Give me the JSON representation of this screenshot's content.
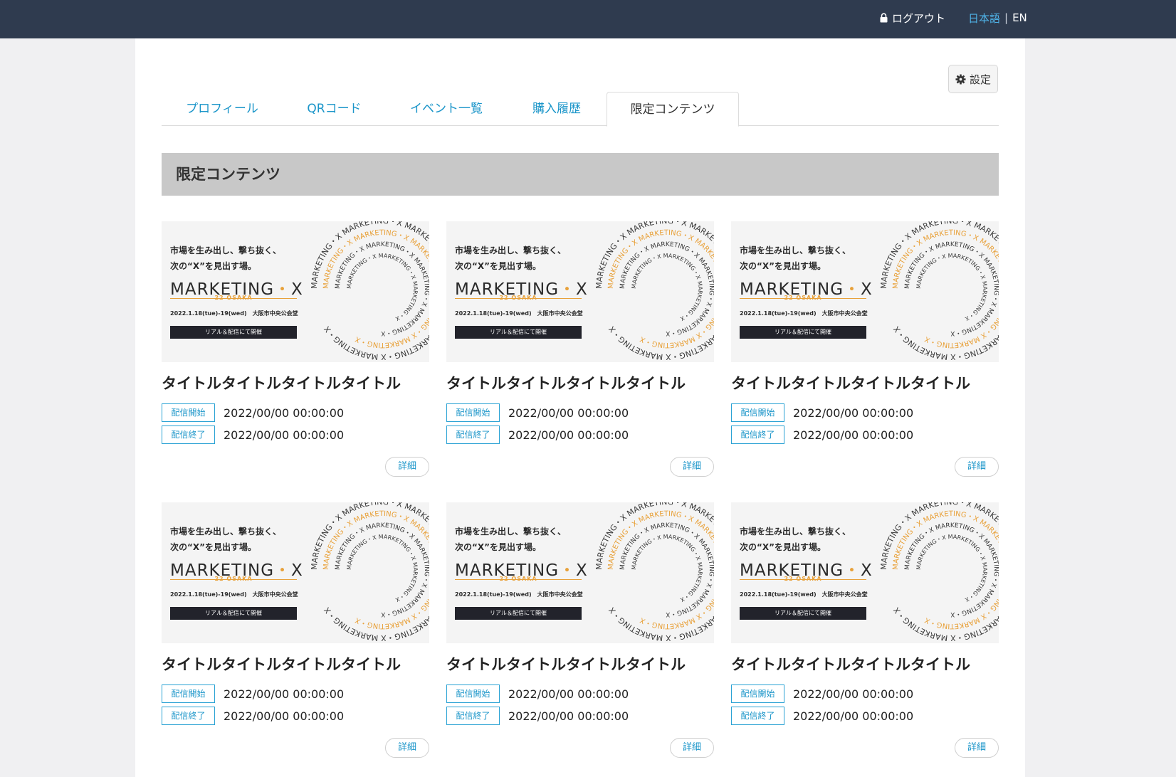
{
  "header": {
    "logout_label": "ログアウト",
    "lang_ja": "日本語",
    "lang_sep": "|",
    "lang_en": "EN"
  },
  "settings_label": "設定",
  "tabs": [
    {
      "label": "プロフィール",
      "active": false
    },
    {
      "label": "QRコード",
      "active": false
    },
    {
      "label": "イベント一覧",
      "active": false
    },
    {
      "label": "購入履歴",
      "active": false
    },
    {
      "label": "限定コンテンツ",
      "active": true
    }
  ],
  "section_title": "限定コンテンツ",
  "thumbnail": {
    "line1": "市場を生み出し、撃ち抜く、",
    "line2": "次の“X”を見出す場。",
    "logo_left": "MARKETING",
    "logo_dot": "・",
    "logo_right": "X",
    "sub": "22 OSAKA",
    "date": "2022.1.18(tue)-19(wed)　大阪市中央公会堂",
    "bar": "リアル＆配信にて開催",
    "ring_text": "MARKETING・X"
  },
  "cards": [
    {
      "title": "タイトルタイトルタイトルタイトル",
      "start_badge": "配信開始",
      "start": "2022/00/00 00:00:00",
      "end_badge": "配信終了",
      "end": "2022/00/00 00:00:00",
      "detail": "詳細"
    },
    {
      "title": "タイトルタイトルタイトルタイトル",
      "start_badge": "配信開始",
      "start": "2022/00/00 00:00:00",
      "end_badge": "配信終了",
      "end": "2022/00/00 00:00:00",
      "detail": "詳細"
    },
    {
      "title": "タイトルタイトルタイトルタイトル",
      "start_badge": "配信開始",
      "start": "2022/00/00 00:00:00",
      "end_badge": "配信終了",
      "end": "2022/00/00 00:00:00",
      "detail": "詳細"
    },
    {
      "title": "タイトルタイトルタイトルタイトル",
      "start_badge": "配信開始",
      "start": "2022/00/00 00:00:00",
      "end_badge": "配信終了",
      "end": "2022/00/00 00:00:00",
      "detail": "詳細"
    },
    {
      "title": "タイトルタイトルタイトルタイトル",
      "start_badge": "配信開始",
      "start": "2022/00/00 00:00:00",
      "end_badge": "配信終了",
      "end": "2022/00/00 00:00:00",
      "detail": "詳細"
    },
    {
      "title": "タイトルタイトルタイトルタイトル",
      "start_badge": "配信開始",
      "start": "2022/00/00 00:00:00",
      "end_badge": "配信終了",
      "end": "2022/00/00 00:00:00",
      "detail": "詳細"
    }
  ],
  "colors": {
    "topbar": "#2f3b4f",
    "link": "#1a95c9",
    "accent_orange": "#e8a13a",
    "section_bg": "#c8c8c8"
  },
  "icons": {
    "logout": "lock-icon",
    "settings": "gear-icon"
  }
}
